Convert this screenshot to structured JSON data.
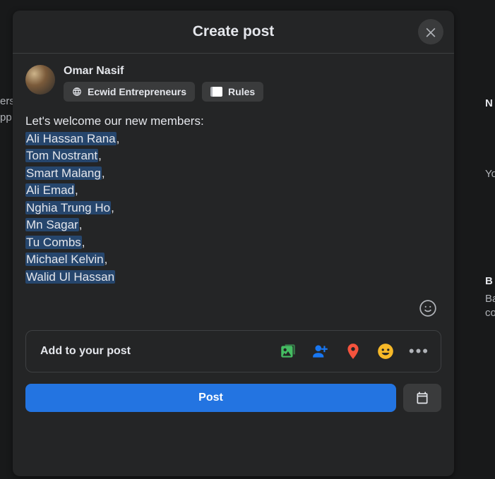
{
  "dialog": {
    "title": "Create post",
    "close_label": "Close"
  },
  "author": {
    "name": "Omar Nasif"
  },
  "audience_chip": {
    "label": "Ecwid Entrepreneurs"
  },
  "rules_chip": {
    "label": "Rules"
  },
  "post": {
    "intro": "Let's welcome our new members:",
    "mentions": [
      "Ali Hassan Rana",
      "Tom Nostrant",
      "Smart Malang",
      "Ali Emad",
      "Nghia Trung Ho",
      "Mn Sagar",
      "Tu Combs",
      "Michael Kelvin",
      "Walid Ul Hassan"
    ]
  },
  "add_bar": {
    "label": "Add to your post"
  },
  "footer": {
    "post_label": "Post"
  },
  "colors": {
    "accent": "#2374e1",
    "mention_bg": "#26466d",
    "photo_icon": "#45bd62",
    "tag_icon": "#1877f2",
    "location_icon": "#f5533d",
    "feeling_icon": "#f7b928"
  }
}
